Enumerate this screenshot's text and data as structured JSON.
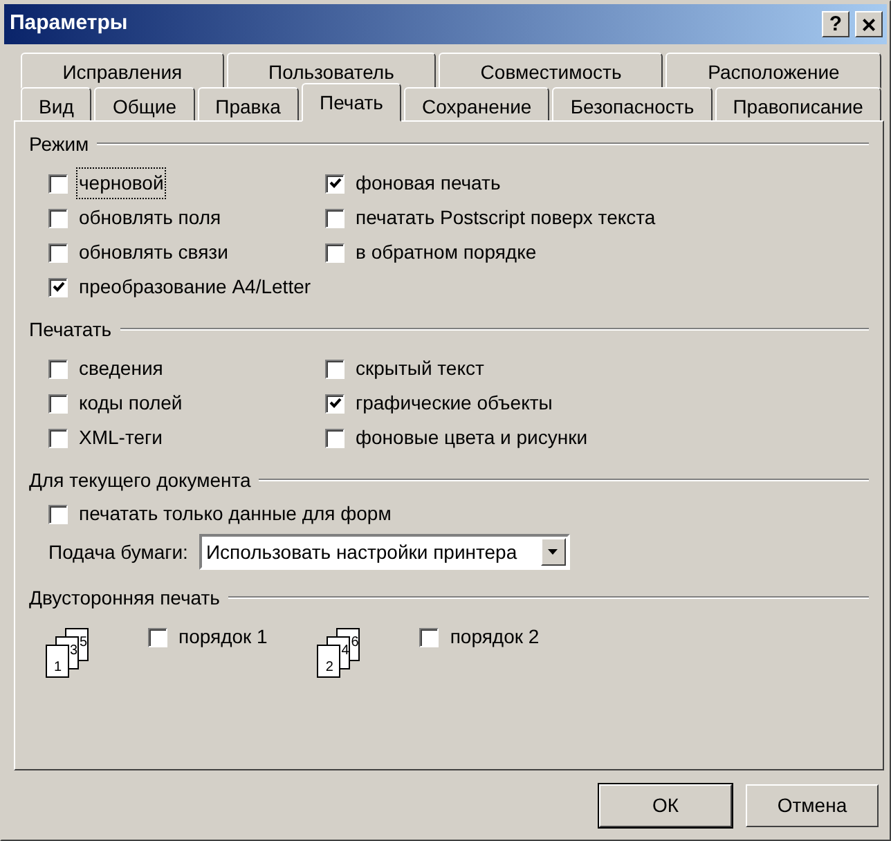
{
  "window": {
    "title": "Параметры",
    "controls": [
      {
        "kind": "help",
        "label": "?"
      },
      {
        "kind": "close",
        "label": "×"
      }
    ]
  },
  "tab_rows": [
    {
      "tabs": [
        {
          "label": "Исправления",
          "selected": false
        },
        {
          "label": "Пользователь",
          "selected": false
        },
        {
          "label": "Совместимость",
          "selected": false
        },
        {
          "label": "Расположение",
          "selected": false
        }
      ]
    },
    {
      "tabs": [
        {
          "label": "Вид",
          "selected": false
        },
        {
          "label": "Общие",
          "selected": false
        },
        {
          "label": "Правка",
          "selected": false
        },
        {
          "label": "Печать",
          "selected": true
        },
        {
          "label": "Сохранение",
          "selected": false
        },
        {
          "label": "Безопасность",
          "selected": false
        },
        {
          "label": "Правописание",
          "selected": false
        }
      ]
    }
  ],
  "sections": [
    {
      "title": "Режим",
      "kind": "columns",
      "columns": [
        [
          {
            "label": "черновой",
            "checked": false,
            "focused": true
          },
          {
            "label": "обновлять поля",
            "checked": false,
            "focused": false
          },
          {
            "label": "обновлять связи",
            "checked": false,
            "focused": false
          },
          {
            "label": "преобразование A4/Letter",
            "checked": true,
            "focused": false
          }
        ],
        [
          {
            "label": "фоновая печать",
            "checked": true,
            "focused": false
          },
          {
            "label": "печатать Postscript поверх текста",
            "checked": false,
            "focused": false
          },
          {
            "label": "в обратном порядке",
            "checked": false,
            "focused": false
          }
        ]
      ]
    },
    {
      "title": "Печатать",
      "kind": "columns",
      "columns": [
        [
          {
            "label": "сведения",
            "checked": false,
            "focused": false
          },
          {
            "label": "коды полей",
            "checked": false,
            "focused": false
          },
          {
            "label": "XML-теги",
            "checked": false,
            "focused": false
          }
        ],
        [
          {
            "label": "скрытый текст",
            "checked": false,
            "focused": false
          },
          {
            "label": "графические объекты",
            "checked": true,
            "focused": false
          },
          {
            "label": "фоновые цвета и рисунки",
            "checked": false,
            "focused": false
          }
        ]
      ]
    },
    {
      "title": "Для текущего документа",
      "kind": "form",
      "checkbox": {
        "label": "печатать только данные для форм",
        "checked": false,
        "focused": false
      },
      "select": {
        "label": "Подача бумаги:",
        "value": "Использовать настройки принтера"
      }
    },
    {
      "title": "Двусторонняя печать",
      "kind": "duplex",
      "options": [
        {
          "pages": [
            "1",
            "3",
            "5"
          ],
          "label": "порядок 1",
          "checked": false,
          "focused": false
        },
        {
          "pages": [
            "2",
            "4",
            "6"
          ],
          "label": "порядок 2",
          "checked": false,
          "focused": false
        }
      ]
    }
  ],
  "buttons": [
    {
      "label": "ОК",
      "default": true
    },
    {
      "label": "Отмена",
      "default": false
    }
  ]
}
